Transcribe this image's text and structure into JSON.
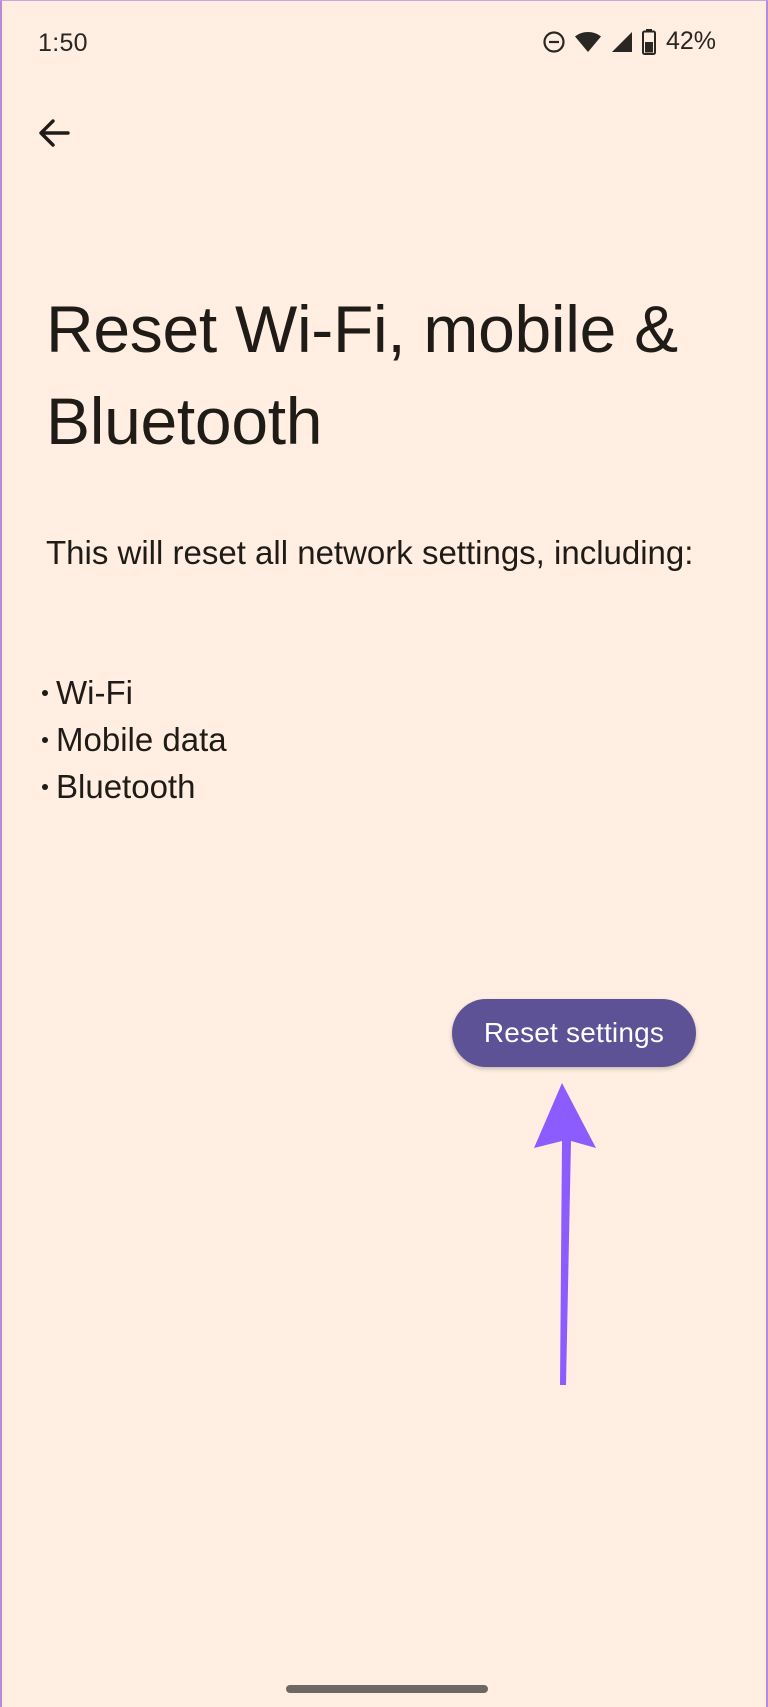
{
  "status_bar": {
    "time": "1:50",
    "battery_percent": "42%",
    "icons": [
      "do-not-disturb-icon",
      "wifi-icon",
      "cellular-signal-icon",
      "battery-icon"
    ]
  },
  "toolbar": {
    "back_icon": "arrow-back-icon"
  },
  "page": {
    "title": "Reset Wi-Fi, mobile & Bluetooth",
    "description": "This will reset all network settings, including:",
    "items": [
      "Wi-Fi",
      "Mobile data",
      "Bluetooth"
    ]
  },
  "actions": {
    "reset_label": "Reset settings"
  },
  "colors": {
    "background": "#FFEEE1",
    "button": "#5E5296",
    "annotation_arrow": "#8C5CFF",
    "text": "#1F1B16"
  }
}
